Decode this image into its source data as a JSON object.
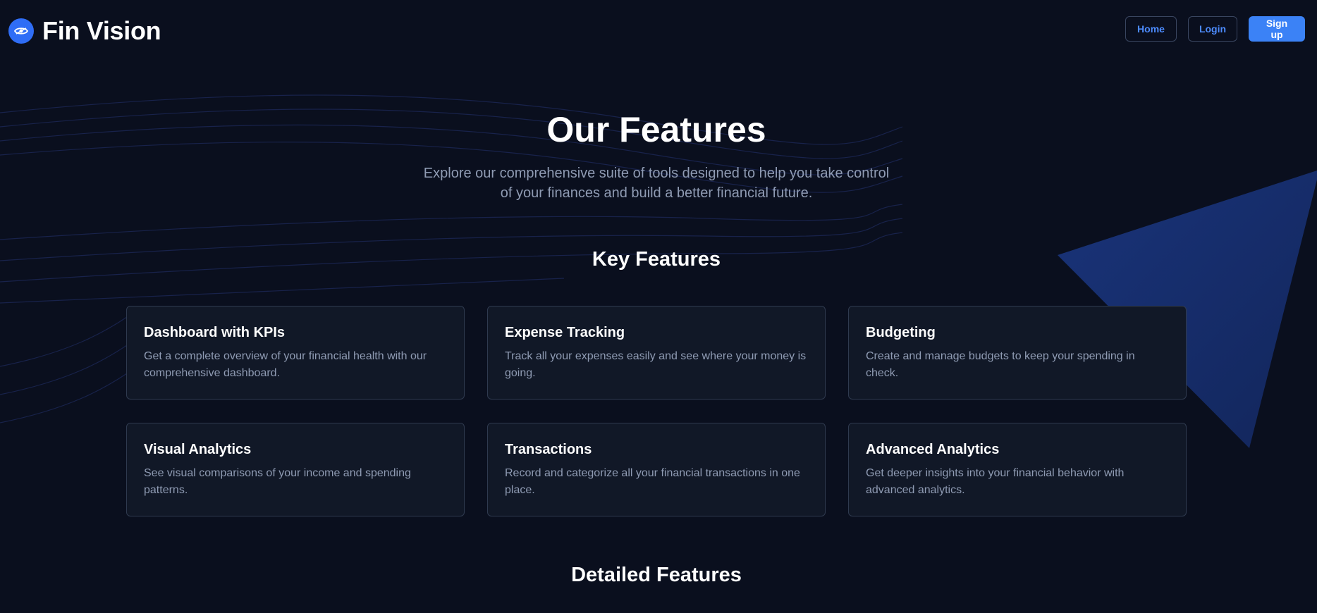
{
  "brand": {
    "name": "Fin Vision",
    "logo_icon": "eye-icon",
    "logo_color": "#2f6df6"
  },
  "nav": {
    "home_label": "Home",
    "login_label": "Login",
    "signup_label": "Sign up"
  },
  "hero": {
    "title": "Our Features",
    "subtitle": "Explore our comprehensive suite of tools designed to help you take control of your finances and build a better financial future."
  },
  "key_features": {
    "title": "Key Features",
    "cards": [
      {
        "title": "Dashboard with KPIs",
        "description": "Get a complete overview of your financial health with our comprehensive dashboard."
      },
      {
        "title": "Expense Tracking",
        "description": "Track all your expenses easily and see where your money is going."
      },
      {
        "title": "Budgeting",
        "description": "Create and manage budgets to keep your spending in check."
      },
      {
        "title": "Visual Analytics",
        "description": "See visual comparisons of your income and spending patterns."
      },
      {
        "title": "Transactions",
        "description": "Record and categorize all your financial transactions in one place."
      },
      {
        "title": "Advanced Analytics",
        "description": "Get deeper insights into your financial behavior with advanced analytics."
      }
    ]
  },
  "detailed_features": {
    "title": "Detailed Features"
  },
  "colors": {
    "background": "#0a0f1e",
    "card_background": "#111827",
    "accent": "#3b82f6",
    "muted_text": "#8f9bb3"
  }
}
